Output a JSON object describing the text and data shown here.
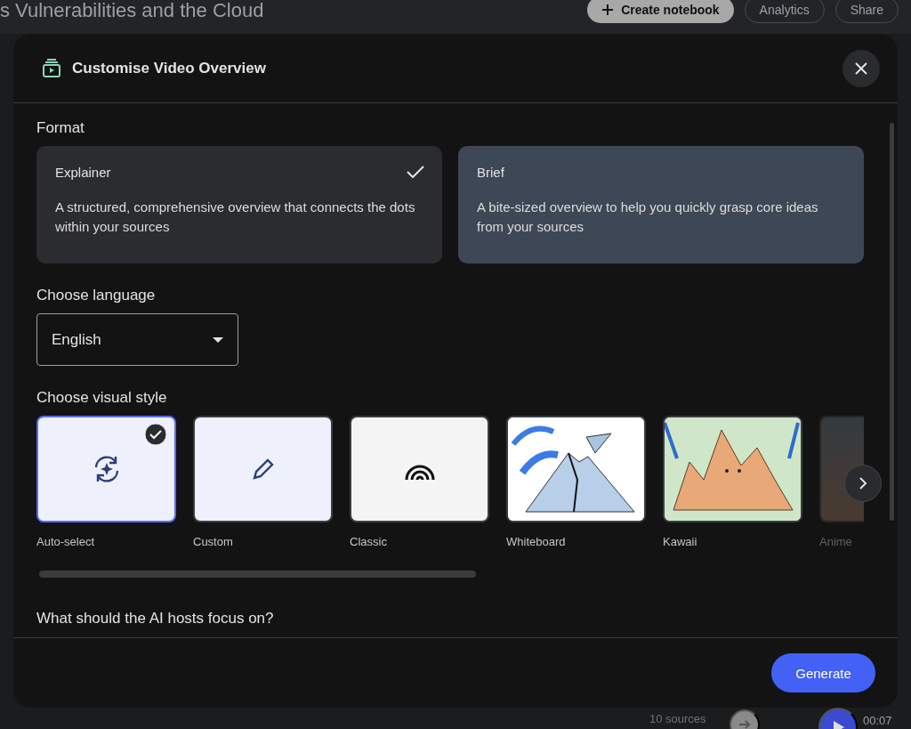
{
  "page": {
    "title": "s Vulnerabilities and the Cloud",
    "buttons": [
      {
        "label": "Create notebook",
        "kind": "filled"
      },
      {
        "label": "Analytics",
        "kind": "outlined"
      },
      {
        "label": "Share",
        "kind": "outlined"
      }
    ],
    "sources_count": "10 sources",
    "time": "00:07"
  },
  "dialog": {
    "title": "Customise Video Overview",
    "format": {
      "heading": "Format",
      "options": [
        {
          "title": "Explainer",
          "description": "A structured, comprehensive overview that connects the dots within your sources",
          "selected": true,
          "hovered": false
        },
        {
          "title": "Brief",
          "description": "A bite-sized overview to help you quickly grasp core ideas from your sources",
          "selected": false,
          "hovered": true
        }
      ]
    },
    "language": {
      "heading": "Choose language",
      "value": "English"
    },
    "visual_style": {
      "heading": "Choose visual style",
      "styles": [
        {
          "label": "Auto-select",
          "kind": "sync",
          "selected": true,
          "faded": false
        },
        {
          "label": "Custom",
          "kind": "pencil",
          "selected": false,
          "faded": false
        },
        {
          "label": "Classic",
          "kind": "arcs",
          "selected": false,
          "faded": false
        },
        {
          "label": "Whiteboard",
          "kind": "mountain",
          "selected": false,
          "faded": false
        },
        {
          "label": "Kawaii",
          "kind": "cartoon",
          "selected": false,
          "faded": false
        },
        {
          "label": "Anime",
          "kind": "landscape",
          "selected": false,
          "faded": true
        }
      ]
    },
    "focus": {
      "heading": "What should the AI hosts focus on?"
    },
    "generate_button": "Generate"
  }
}
